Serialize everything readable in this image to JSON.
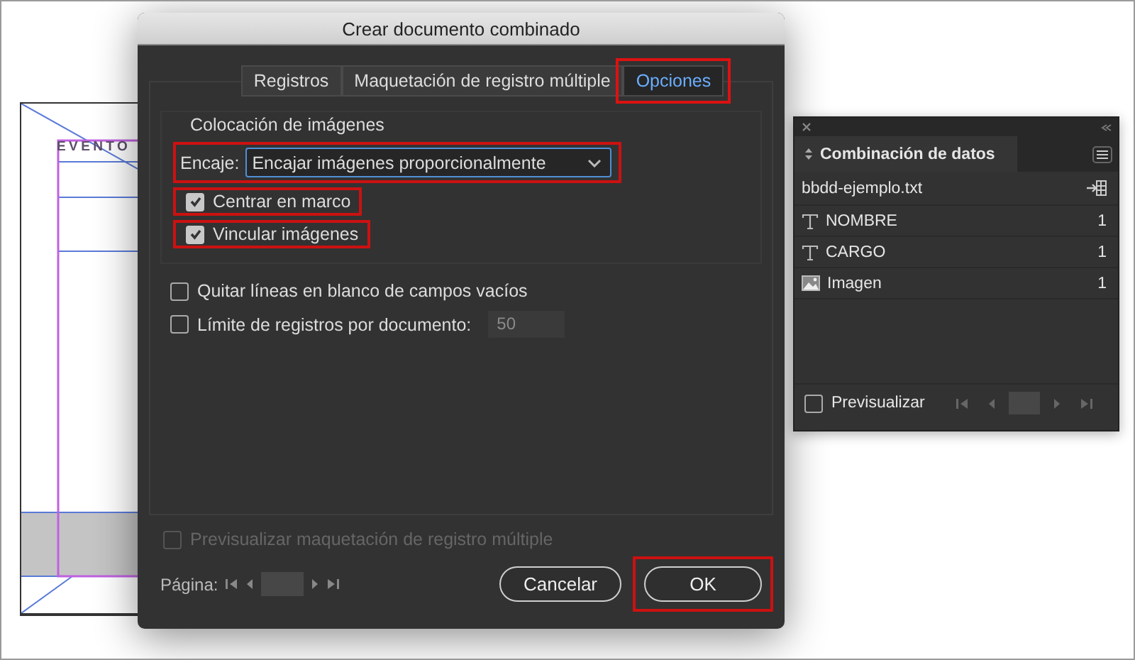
{
  "document": {
    "heading": "EVENTO"
  },
  "dialog": {
    "title": "Crear documento combinado",
    "tabs": [
      {
        "label": "Registros",
        "selected": false,
        "highlighted": false
      },
      {
        "label": "Maquetación de registro múltiple",
        "selected": false,
        "highlighted": false
      },
      {
        "label": "Opciones",
        "selected": true,
        "highlighted": true
      }
    ],
    "image_placement": {
      "heading": "Colocación de imágenes",
      "fit_label": "Encaje:",
      "fit_value": "Encajar imágenes proporcionalmente",
      "fit_highlighted": true,
      "options": [
        {
          "label": "Centrar en marco",
          "checked": true,
          "highlighted": true
        },
        {
          "label": "Vincular imágenes",
          "checked": true,
          "highlighted": true
        }
      ]
    },
    "options": [
      {
        "label": "Quitar líneas en blanco de campos vacíos",
        "checked": false
      },
      {
        "label": "Límite de registros por documento:",
        "checked": false,
        "value": "50"
      }
    ],
    "preview": {
      "label": "Previsualizar maquetación de registro múltiple",
      "checked": false,
      "disabled": true
    },
    "page_label": "Página:",
    "buttons": [
      {
        "label": "Cancelar",
        "highlighted": false
      },
      {
        "label": "OK",
        "highlighted": true
      }
    ]
  },
  "panel": {
    "title": "Combinación de datos",
    "source": "bbdd-ejemplo.txt",
    "fields": [
      {
        "kind": "text",
        "name": "NOMBRE",
        "count": "1"
      },
      {
        "kind": "text",
        "name": "CARGO",
        "count": "1"
      },
      {
        "kind": "image",
        "name": "Imagen",
        "count": "1"
      }
    ],
    "preview": {
      "label": "Previsualizar",
      "checked": false
    }
  }
}
